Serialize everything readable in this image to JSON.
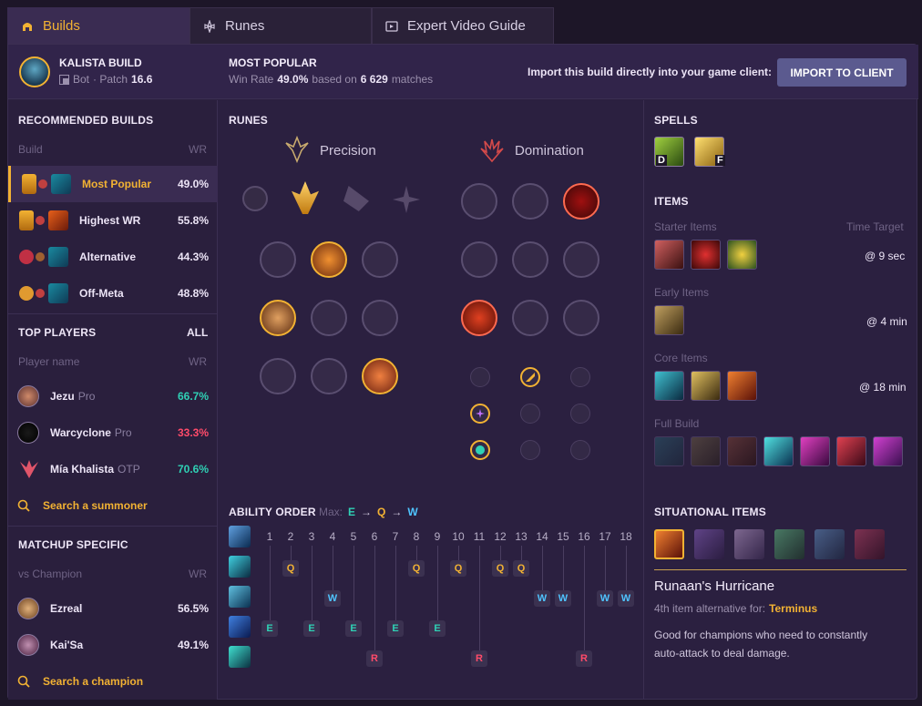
{
  "tabs": [
    {
      "label": "Builds"
    },
    {
      "label": "Runes"
    },
    {
      "label": "Expert Video Guide"
    }
  ],
  "header": {
    "champ": "KALISTA BUILD",
    "role": "Bot",
    "patch_prefix": "· Patch",
    "patch": "16.6",
    "popular": "MOST POPULAR",
    "wr_label": "Win Rate",
    "wr": "49.0%",
    "based": "based on",
    "matches": "6 629",
    "matches_suffix": "matches",
    "import_text": "Import this build directly into your game client:",
    "import_btn": "IMPORT TO CLIENT"
  },
  "recommended": {
    "title": "RECOMMENDED BUILDS",
    "col_build": "Build",
    "col_wr": "WR",
    "items": [
      {
        "label": "Most Popular",
        "wr": "49.0%"
      },
      {
        "label": "Highest WR",
        "wr": "55.8%"
      },
      {
        "label": "Alternative",
        "wr": "44.3%"
      },
      {
        "label": "Off-Meta",
        "wr": "48.8%"
      }
    ]
  },
  "top_players": {
    "title": "TOP PLAYERS",
    "all": "ALL",
    "col_name": "Player name",
    "col_wr": "WR",
    "items": [
      {
        "name": "Jezu",
        "tag": "Pro",
        "wr": "66.7%"
      },
      {
        "name": "Warcyclone",
        "tag": "Pro",
        "wr": "33.3%"
      },
      {
        "name": "Mía Khalista",
        "tag": "OTP",
        "wr": "70.6%"
      }
    ],
    "search": "Search a summoner"
  },
  "matchup": {
    "title": "MATCHUP SPECIFIC",
    "col_vs": "vs Champion",
    "col_wr": "WR",
    "items": [
      {
        "name": "Ezreal",
        "wr": "56.5%"
      },
      {
        "name": "Kai'Sa",
        "wr": "49.1%"
      }
    ],
    "search": "Search a champion"
  },
  "runes": {
    "title": "RUNES",
    "primary": "Precision",
    "secondary": "Domination"
  },
  "spells": {
    "title": "SPELLS",
    "keys": [
      "D",
      "F"
    ]
  },
  "items": {
    "title": "ITEMS",
    "starter": "Starter Items",
    "time_target": "Time Target",
    "starter_time": "@ 9 sec",
    "early": "Early Items",
    "early_time": "@ 4 min",
    "core": "Core Items",
    "core_time": "@ 18 min",
    "full": "Full Build"
  },
  "ability": {
    "title": "ABILITY ORDER",
    "max": "Max:",
    "order": [
      "E",
      "Q",
      "W"
    ],
    "arrow": "→",
    "levels": [
      "1",
      "2",
      "3",
      "4",
      "5",
      "6",
      "7",
      "8",
      "9",
      "10",
      "11",
      "12",
      "13",
      "14",
      "15",
      "16",
      "17",
      "18"
    ],
    "skills": [
      "Q",
      "W",
      "E",
      "R"
    ]
  },
  "situational": {
    "title": "SITUATIONAL ITEMS",
    "item": "Runaan's Hurricane",
    "alt_prefix": "4th item alternative for:",
    "alt_item": "Terminus",
    "desc": "Good for champions who need to constantly auto-attack to deal damage."
  },
  "colors": {
    "gold": "#f2b233",
    "teal": "#2fd1b5",
    "red": "#ff4b6a",
    "blue": "#4fc4ff"
  }
}
